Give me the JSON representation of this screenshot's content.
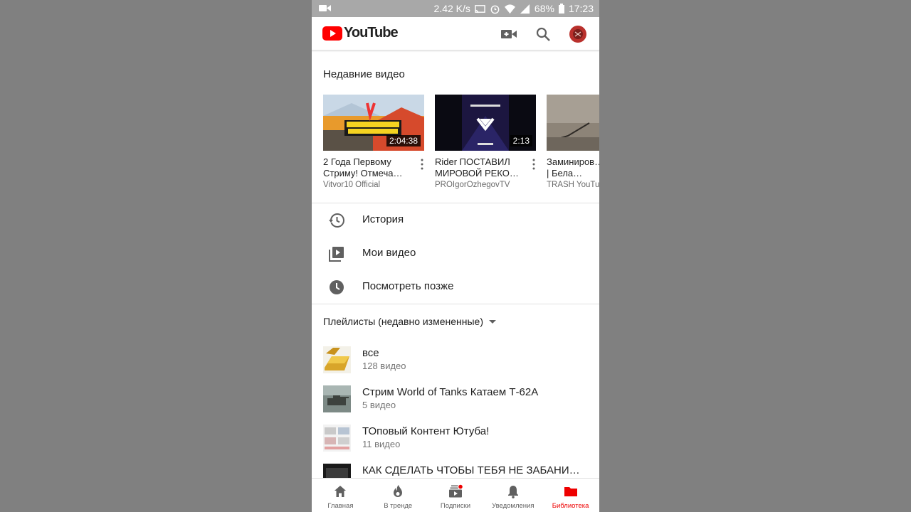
{
  "status_bar": {
    "speed": "2.42 K/s",
    "battery": "68%",
    "time": "17:23"
  },
  "app": {
    "brand": "YouTube",
    "brand_color": "#ff0000"
  },
  "recent": {
    "title": "Недавние видео",
    "videos": [
      {
        "title": "2 Года Первому Стриму! Отмеча…",
        "channel": "Vitvor10 Official",
        "duration": "2:04:38"
      },
      {
        "title": "Rider  ПОСТАВИЛ МИРОВОЙ РЕКО…",
        "channel": "PROIgorOzhegovTV",
        "duration": "2:13"
      },
      {
        "title": "Заминиров… тапок | Бела…",
        "channel": "TRASH YouTu…",
        "duration": ""
      }
    ]
  },
  "menu": [
    {
      "label": "История",
      "icon": "history-icon"
    },
    {
      "label": "Мои видео",
      "icon": "my-videos-icon"
    },
    {
      "label": "Посмотреть позже",
      "icon": "watch-later-icon"
    }
  ],
  "playlists": {
    "header": "Плейлисты (недавно измененные)",
    "items": [
      {
        "title": "все",
        "count": "128 видео"
      },
      {
        "title": "Стрим World of Tanks Катаем Т-62А",
        "count": "5 видео"
      },
      {
        "title": "ТОповый Контент Ютуба!",
        "count": "11 видео"
      },
      {
        "title": "КАК СДЕЛАТЬ ЧТОБЫ ТЕБЯ НЕ ЗАБАНИ…",
        "count": ""
      }
    ]
  },
  "bottom_nav": [
    {
      "label": "Главная",
      "icon": "home-icon"
    },
    {
      "label": "В тренде",
      "icon": "trending-icon"
    },
    {
      "label": "Подписки",
      "icon": "subscriptions-icon"
    },
    {
      "label": "Уведомления",
      "icon": "bell-icon"
    },
    {
      "label": "Библиотека",
      "icon": "library-icon",
      "active": true
    }
  ],
  "colors": {
    "accent": "#ee0000",
    "text": "#212121",
    "secondary": "#757575"
  }
}
